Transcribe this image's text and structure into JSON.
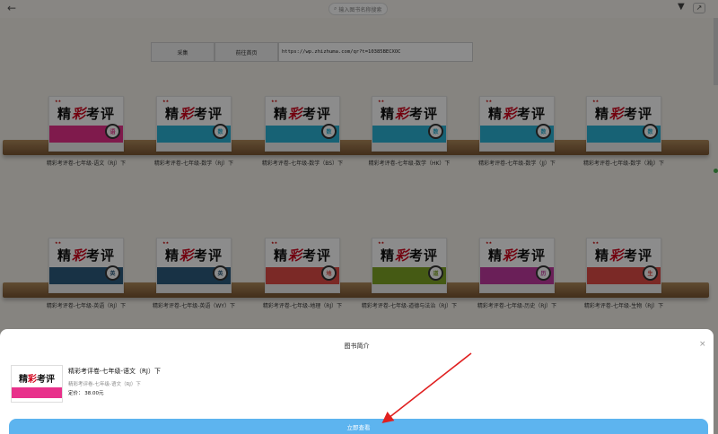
{
  "topbar": {
    "back_icon": "back-arrow-icon",
    "search_placeholder": "输入图书名称搜索",
    "filter_icon": "filter-icon",
    "share_icon": "share-icon"
  },
  "actions": {
    "collect_label": "采集",
    "home_label": "前往首页",
    "url_value": "https://wp.zhizhuma.com/qr?t=10385BECXOC"
  },
  "book_brand": "★★",
  "shelves": [
    {
      "books": [
        {
          "title": "精彩考评卷-七年级-语文（RJ）下",
          "color": "#e8318b",
          "tag": "语"
        },
        {
          "title": "精彩考评卷-七年级-数学（RJ）下",
          "color": "#2bb3d6",
          "tag": "数"
        },
        {
          "title": "精彩考评卷-七年级-数学（BS）下",
          "color": "#2bb3d6",
          "tag": "数"
        },
        {
          "title": "精彩考评卷-七年级-数学（HK）下",
          "color": "#2bb3d6",
          "tag": "数"
        },
        {
          "title": "精彩考评卷-七年级-数学（JJ）下",
          "color": "#2bb3d6",
          "tag": "数"
        },
        {
          "title": "精彩考评卷-七年级-数学（湘J）下",
          "color": "#2bb3d6",
          "tag": "数"
        }
      ]
    },
    {
      "books": [
        {
          "title": "精彩考评卷-七年级-英语（RJ）下",
          "color": "#2d5c7f",
          "tag": "英"
        },
        {
          "title": "精彩考评卷-七年级-英语（WY）下",
          "color": "#2d5c7f",
          "tag": "英"
        },
        {
          "title": "精彩考评卷-七年级-地理（RJ）下",
          "color": "#e14b46",
          "tag": "地"
        },
        {
          "title": "精彩考评卷-七年级-道德与法治（RJ）下",
          "color": "#7fa526",
          "tag": "道"
        },
        {
          "title": "精彩考评卷-七年级-历史（RJ）下",
          "color": "#c23aa0",
          "tag": "历"
        },
        {
          "title": "精彩考评卷-七年级-生物（RJ）下",
          "color": "#e14b46",
          "tag": "生"
        }
      ]
    }
  ],
  "sheet": {
    "title": "图书简介",
    "close_icon": "close-icon",
    "book_name": "精彩考评卷-七年级-语文（RJ）下",
    "book_subtitle": "精彩考评卷-七年级-语文（RJ）下",
    "price": "定价： 38.00元",
    "cta_label": "立即查看",
    "thumb_color": "#e8318b"
  },
  "logo": {
    "left": "精",
    "mid": "彩",
    "right": "考评"
  }
}
